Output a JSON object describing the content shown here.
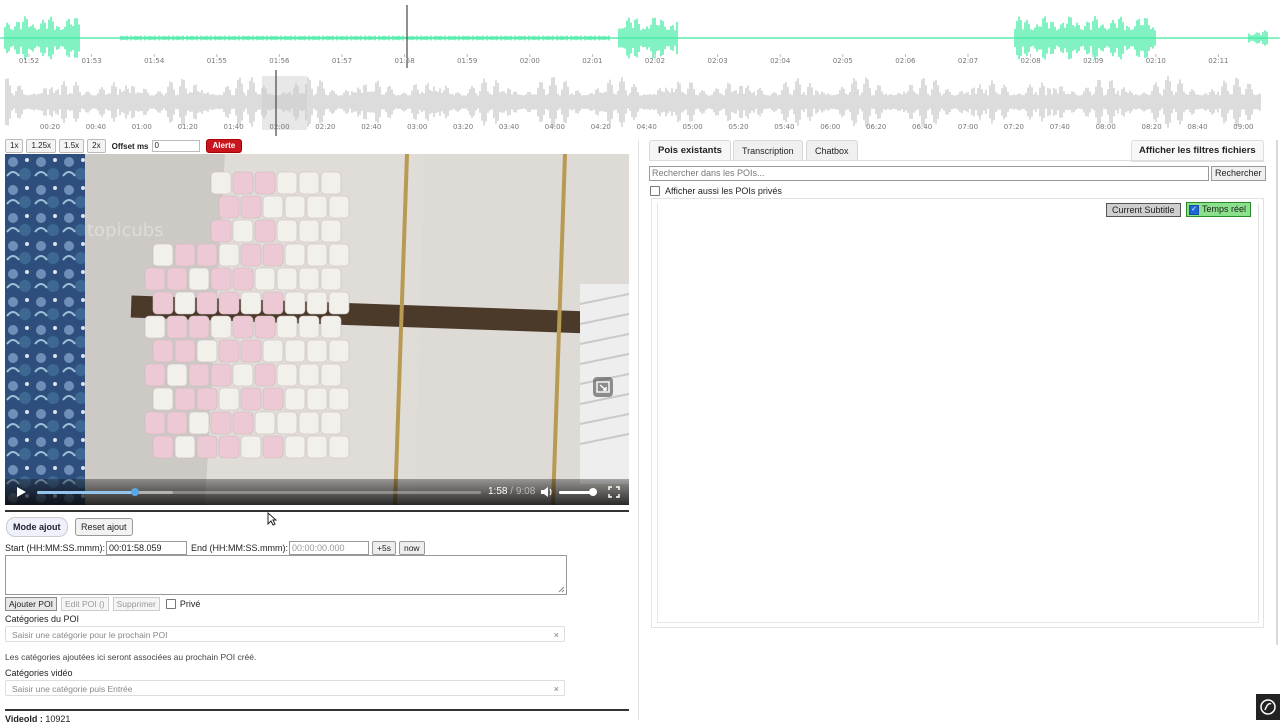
{
  "colors": {
    "wave_active": "#2ee89a",
    "wave_mini": "#c8c8c8",
    "alert": "#c8151e",
    "live_toggle": "#8be08b"
  },
  "waveform": {
    "tick_labels": [
      "01:52",
      "01:53",
      "01:54",
      "01:55",
      "01:56",
      "01:57",
      "01:58",
      "01:59",
      "02:00",
      "02:01",
      "02:02",
      "02:03",
      "02:04",
      "02:05",
      "02:06",
      "02:07",
      "02:08",
      "02:09",
      "02:10",
      "02:11"
    ]
  },
  "overview": {
    "tick_labels": [
      "00:20",
      "00:40",
      "01:00",
      "01:20",
      "01:40",
      "02:00",
      "02:20",
      "02:40",
      "03:00",
      "03:20",
      "03:40",
      "04:00",
      "04:20",
      "04:40",
      "05:00",
      "05:20",
      "05:40",
      "06:00",
      "06:20",
      "06:40",
      "07:00",
      "07:20",
      "07:40",
      "08:00",
      "08:20",
      "08:40",
      "09:00"
    ]
  },
  "speed": {
    "buttons": [
      "1x",
      "1.25x",
      "1.5x",
      "2x"
    ],
    "offset_label": "Offset ms",
    "offset_value": "0",
    "alert_label": "Alerte"
  },
  "player": {
    "current_time": "1:58",
    "separator": "/",
    "duration": "9:08",
    "progress": 0.22,
    "volume": 0.9,
    "watermark": "topicubs"
  },
  "form": {
    "mode_label": "Mode ajout",
    "reset_label": "Reset ajout",
    "start_label": "Start (HH:MM:SS.mmm):",
    "start_value": "00:01:58.059",
    "end_label": "End (HH:MM:SS.mmm):",
    "end_placeholder": "00:00:00.000",
    "plus5_label": "+5s",
    "now_label": "now",
    "add_label": "Ajouter POI",
    "edit_label": "Edit POI ()",
    "delete_label": "Supprimer",
    "private_label": "Privé",
    "poi_categories_label": "Catégories du POI",
    "poi_categories_placeholder": "Saisir une catégorie pour le prochain POI",
    "poi_categories_note": "Les catégories ajoutées ici seront associées au prochain POI créé.",
    "video_categories_label": "Catégories vidéo",
    "video_categories_placeholder": "Saisir une catégorie puis Entrée",
    "clear_symbol": "×",
    "video_id_label": "VideoId :",
    "video_id_value": "10921"
  },
  "panel": {
    "tabs": [
      "Pois existants",
      "Transcription",
      "Chatbox"
    ],
    "filters_label": "Afficher les filtres fichiers",
    "search_placeholder": "Rechercher dans les POIs...",
    "search_button": "Rechercher",
    "show_private_label": "Afficher aussi les POIs privés",
    "current_subtitle_label": "Current Subtitle",
    "live_label": "Temps réel"
  }
}
